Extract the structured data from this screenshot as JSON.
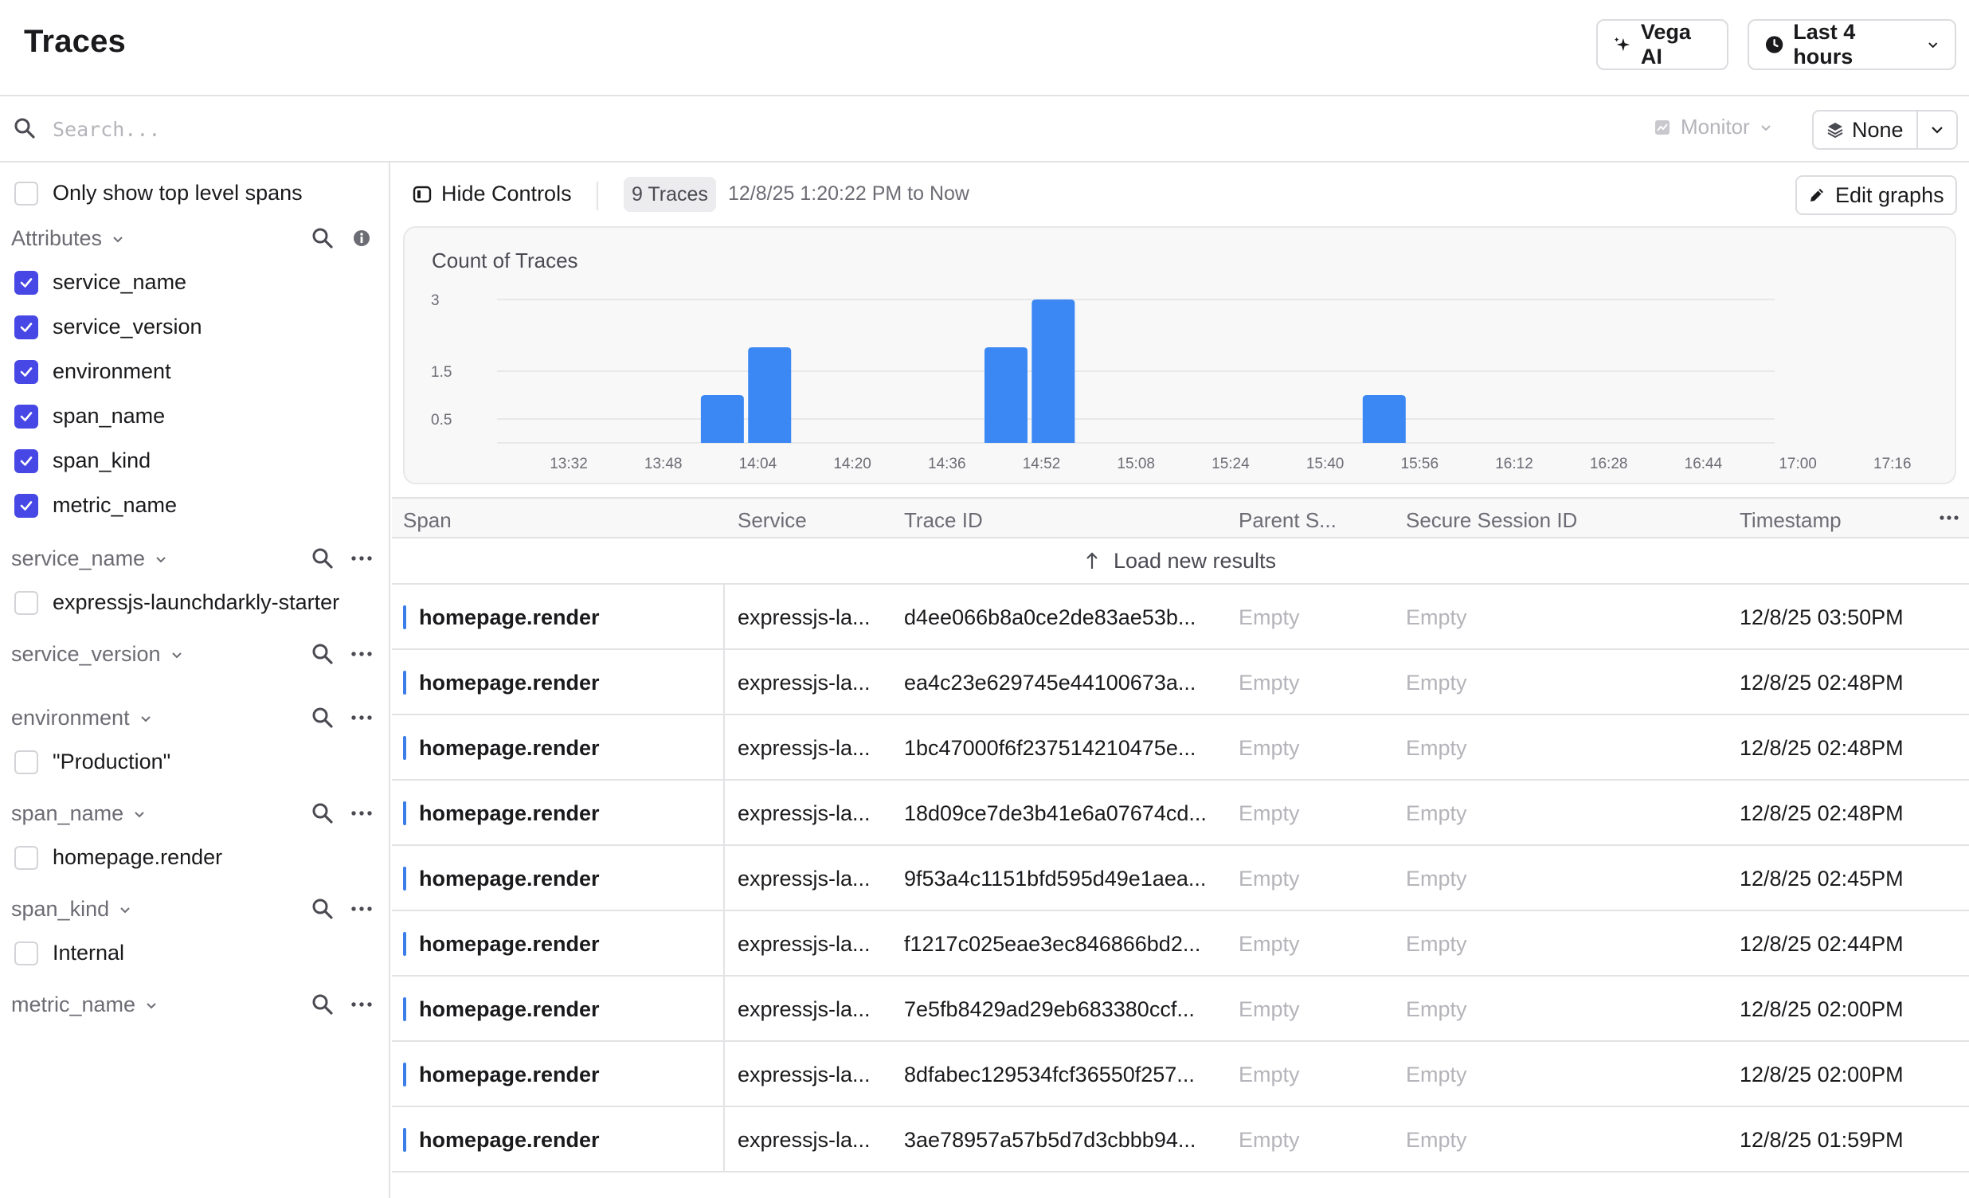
{
  "header": {
    "title": "Traces",
    "vega_label": "Vega AI",
    "time_range_label": "Last 4 hours"
  },
  "search": {
    "placeholder": "Search...",
    "value": "",
    "monitor_label": "Monitor",
    "group_label": "None"
  },
  "sidebar": {
    "top_level_label": "Only show top level spans",
    "top_level_checked": false,
    "attributes_title": "Attributes",
    "attributes": [
      {
        "label": "service_name",
        "checked": true
      },
      {
        "label": "service_version",
        "checked": true
      },
      {
        "label": "environment",
        "checked": true
      },
      {
        "label": "span_name",
        "checked": true
      },
      {
        "label": "span_kind",
        "checked": true
      },
      {
        "label": "metric_name",
        "checked": true
      }
    ],
    "facets": [
      {
        "title": "service_name",
        "values": [
          "expressjs-launchdarkly-starter"
        ]
      },
      {
        "title": "service_version",
        "values": []
      },
      {
        "title": "environment",
        "values": [
          "\"Production\""
        ]
      },
      {
        "title": "span_name",
        "values": [
          "homepage.render"
        ]
      },
      {
        "title": "span_kind",
        "values": [
          "Internal"
        ]
      },
      {
        "title": "metric_name",
        "values": []
      }
    ]
  },
  "toolbar": {
    "hide_controls_label": "Hide Controls",
    "traces_count_label": "9 Traces",
    "range_text": "12/8/25 1:20:22 PM to Now",
    "edit_graphs_label": "Edit graphs"
  },
  "chart_data": {
    "type": "bar",
    "title": "Count of Traces",
    "bar_color": "#3b88f5",
    "y_ticks": [
      "3",
      "1.5",
      "0.5"
    ],
    "x_ticks": [
      "13:32",
      "13:48",
      "14:04",
      "14:20",
      "14:36",
      "14:52",
      "15:08",
      "15:24",
      "15:40",
      "15:56",
      "16:12",
      "16:28",
      "16:44",
      "17:00",
      "17:16"
    ],
    "ylim": [
      0,
      3
    ],
    "bars": [
      {
        "time": "13:58",
        "value": 1
      },
      {
        "time": "14:06",
        "value": 2
      },
      {
        "time": "14:46",
        "value": 2
      },
      {
        "time": "14:54",
        "value": 3
      },
      {
        "time": "15:50",
        "value": 1
      }
    ]
  },
  "table": {
    "columns": [
      "Span",
      "Service",
      "Trace ID",
      "Parent S...",
      "Secure Session ID",
      "Timestamp"
    ],
    "load_new_label": "Load new results",
    "rows": [
      {
        "span": "homepage.render",
        "service": "expressjs-la...",
        "trace_id": "d4ee066b8a0ce2de83ae53b...",
        "parent": "Empty",
        "session": "Empty",
        "timestamp": "12/8/25 03:50PM"
      },
      {
        "span": "homepage.render",
        "service": "expressjs-la...",
        "trace_id": "ea4c23e629745e44100673a...",
        "parent": "Empty",
        "session": "Empty",
        "timestamp": "12/8/25 02:48PM"
      },
      {
        "span": "homepage.render",
        "service": "expressjs-la...",
        "trace_id": "1bc47000f6f237514210475e...",
        "parent": "Empty",
        "session": "Empty",
        "timestamp": "12/8/25 02:48PM"
      },
      {
        "span": "homepage.render",
        "service": "expressjs-la...",
        "trace_id": "18d09ce7de3b41e6a07674cd...",
        "parent": "Empty",
        "session": "Empty",
        "timestamp": "12/8/25 02:48PM"
      },
      {
        "span": "homepage.render",
        "service": "expressjs-la...",
        "trace_id": "9f53a4c1151bfd595d49e1aea...",
        "parent": "Empty",
        "session": "Empty",
        "timestamp": "12/8/25 02:45PM"
      },
      {
        "span": "homepage.render",
        "service": "expressjs-la...",
        "trace_id": "f1217c025eae3ec846866bd2...",
        "parent": "Empty",
        "session": "Empty",
        "timestamp": "12/8/25 02:44PM"
      },
      {
        "span": "homepage.render",
        "service": "expressjs-la...",
        "trace_id": "7e5fb8429ad29eb683380ccf...",
        "parent": "Empty",
        "session": "Empty",
        "timestamp": "12/8/25 02:00PM"
      },
      {
        "span": "homepage.render",
        "service": "expressjs-la...",
        "trace_id": "8dfabec129534fcf36550f257...",
        "parent": "Empty",
        "session": "Empty",
        "timestamp": "12/8/25 02:00PM"
      },
      {
        "span": "homepage.render",
        "service": "expressjs-la...",
        "trace_id": "3ae78957a57b5d7d3cbbb94...",
        "parent": "Empty",
        "session": "Empty",
        "timestamp": "12/8/25 01:59PM"
      }
    ]
  },
  "icons": {
    "vega": "sparkle-icon",
    "time": "clock-icon",
    "search": "search-icon",
    "monitor": "monitor-icon",
    "group": "layers-icon",
    "hide_controls": "sidebar-panel-icon",
    "edit": "pencil-icon",
    "more": "more-dots-icon",
    "load": "arrow-up-icon"
  }
}
